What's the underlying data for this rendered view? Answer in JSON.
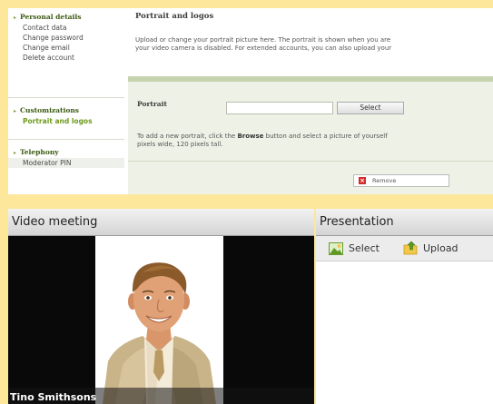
{
  "settings": {
    "sidebar": {
      "groups": [
        {
          "header": "Personal details",
          "items": [
            "Contact data",
            "Change password",
            "Change email",
            "Delete account"
          ]
        },
        {
          "header": "Customizations",
          "items": [
            "Portrait and logos"
          ],
          "active_index": 0
        },
        {
          "header": "Telephony",
          "items": [
            "Moderator PIN"
          ]
        }
      ]
    },
    "content": {
      "title": "Portrait and logos",
      "description_line1": "Upload or change your portrait picture here. The portrait is shown when you are",
      "description_line2": "your video camera is disabled. For extended accounts, you can also upload your",
      "portrait_label": "Portrait",
      "file_value": "",
      "select_label": "Select",
      "hint_before": "To add a new portrait, click the ",
      "hint_bold": "Browse",
      "hint_after": " button and select a picture of yourself",
      "hint_line2": "pixels wide, 120 pixels tall.",
      "remove_label": "Remove"
    }
  },
  "video_meeting": {
    "title": "Video meeting",
    "participant_name": "Tino Smithsons"
  },
  "presentation": {
    "title": "Presentation",
    "toolbar": {
      "select_label": "Select",
      "upload_label": "Upload"
    }
  },
  "colors": {
    "page_background": "#fde79a",
    "accent_green": "#6d9a1c",
    "remove_icon": "#d32b2b"
  }
}
